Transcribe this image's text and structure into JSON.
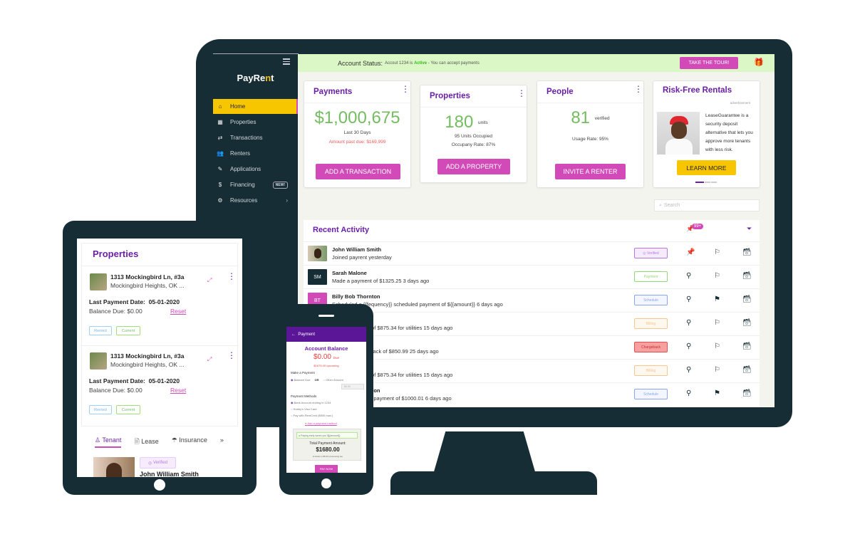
{
  "app": {
    "name_prefix": "PayRe",
    "name_accent": "n",
    "name_suffix": "t"
  },
  "sidebar": {
    "items": [
      {
        "label": "Home",
        "icon": "home-icon",
        "glyph": "⌂",
        "active": true
      },
      {
        "label": "Properties",
        "icon": "properties-icon",
        "glyph": "▦"
      },
      {
        "label": "Transactions",
        "icon": "transactions-icon",
        "glyph": "⇄"
      },
      {
        "label": "Renters",
        "icon": "renters-icon",
        "glyph": "👥"
      },
      {
        "label": "Applications",
        "icon": "applications-icon",
        "glyph": "✎"
      },
      {
        "label": "Financing",
        "icon": "money-bag-icon",
        "glyph": "$",
        "badge": "NEW!"
      },
      {
        "label": "Resources",
        "icon": "resources-icon",
        "glyph": "⚙",
        "chevron": "›"
      }
    ]
  },
  "status": {
    "label": "Account Status:",
    "msg_prefix": "Accout 1234 is",
    "state": "Active",
    "msg_suffix": "- You can accept payments",
    "tour_button": "TAKE THE TOUR!"
  },
  "cards": {
    "payments": {
      "title": "Payments",
      "amount": "$1,000,675",
      "period": "Last 30 Days",
      "past_due": "Amount past due: $169,999",
      "button": "ADD A TRANSACTION"
    },
    "properties": {
      "title": "Properties",
      "count": "180",
      "unit": "units",
      "occupied": "95 Units Occupied",
      "rate": "Occupany Rate: 87%",
      "button": "ADD A PROPERTY"
    },
    "people": {
      "title": "People",
      "count": "81",
      "unit": "verified",
      "usage": "Usage Rate: 95%",
      "button": "INVITE A RENTER"
    },
    "ad": {
      "title": "Risk-Free Rentals",
      "label": "advertisement",
      "text": "LeaseGuarantee is a security deposit alternative that lets you approve more tenants with less risk.",
      "button": "LEARN MORE"
    }
  },
  "search": {
    "placeholder": "Search"
  },
  "activity": {
    "title": "Recent Activity",
    "pin_count": "99+",
    "rows": [
      {
        "name": "John William Smith",
        "desc": "Joined payrent yesterday",
        "initials": "",
        "avatar_color": "#8a6a50",
        "tag": "Verified",
        "tag_color": "#b57ae0",
        "tag_bg": "#f5ebfd",
        "pinned": true,
        "flagged": false
      },
      {
        "name": "Sarah Malone",
        "desc": "Made a payment of $1325.25 3 days ago",
        "initials": "SM",
        "avatar_color": "#172d35",
        "tag": "Payment",
        "tag_color": "#8fd874",
        "tag_bg": "#ffffff",
        "pinned": false,
        "flagged": false
      },
      {
        "name": "Billy Bob Thornton",
        "desc": "Scheduled a {{fequency}} scheduled payment of ${{amount}} 6 days ago",
        "initials": "BT",
        "avatar_color": "#d14ab8",
        "tag": "Schedule",
        "tag_color": "#8aa6f0",
        "tag_bg": "#f3f6ff",
        "pinned": false,
        "flagged": true
      },
      {
        "name": "",
        "desc": "Added a charge of $875.34 for utilities 15 days ago",
        "initials": "",
        "avatar_color": "#ffffff",
        "tag": "Billing",
        "tag_color": "#f4c690",
        "tag_bg": "#fff8ee",
        "pinned": false,
        "flagged": false
      },
      {
        "name": "",
        "desc": "Issued a chargeback of $850.99 25 days ago",
        "initials": "",
        "avatar_color": "#ffffff",
        "tag": "Chargeback",
        "tag_color": "#e05050",
        "tag_bg": "#f8a0a0",
        "pinned": false,
        "flagged": false
      },
      {
        "name": "",
        "desc": "Added a charge of $875.34 for utilities 15 days ago",
        "initials": "",
        "avatar_color": "#ffffff",
        "tag": "Billing",
        "tag_color": "#f4c690",
        "tag_bg": "#fff8ee",
        "pinned": false,
        "flagged": false
      },
      {
        "name": "Billy Bob Thornton",
        "desc": "Made a one-time payment of $1000.01 6 days ago",
        "initials": "",
        "avatar_color": "#ffffff",
        "tag": "Schedule",
        "tag_color": "#8aa6f0",
        "tag_bg": "#f3f6ff",
        "pinned": false,
        "flagged": true
      }
    ]
  },
  "tablet": {
    "title": "Properties",
    "properties": [
      {
        "address": "1313 Mockingbird Ln, #3a",
        "city": "Mockingbird Heights, OK ...",
        "last_payment_label": "Last Payment Date:",
        "last_payment": "05-01-2020",
        "balance": "Balance Due: $0.00",
        "reset": "Reset",
        "tags": [
          "Rented",
          "Current"
        ]
      },
      {
        "address": "1313 Mockingbird Ln, #3a",
        "city": "Mockingbird Heights, OK ...",
        "last_payment_label": "Last Payment Date:",
        "last_payment": "05-01-2020",
        "balance": "Balance Due: $0.00",
        "reset": "Reset",
        "tags": [
          "Rented",
          "Current"
        ]
      }
    ],
    "tabs": [
      "Tenant",
      "Lease",
      "Insurance"
    ],
    "more": "»",
    "tenant": {
      "badge": "Verified",
      "name": "John William Smith"
    }
  },
  "phone": {
    "header": "Payment",
    "balance_title": "Account Balance",
    "balance": "$0.00",
    "due_label": "Due",
    "upcoming": "$1675.00 upcoming",
    "make_payment": "Make a Payment",
    "option_due": "Balance Due",
    "or": "OR",
    "option_other": "Other Amount",
    "other_value": "$0.00",
    "methods_title": "Payment Methods",
    "methods": [
      "Bank Account ending in 1234",
      "Hubby's Visa Card",
      "Pay with RentCred ($500 max.)"
    ],
    "add_method": "Add a payment method",
    "early_note": "Paying early saves you ${{amount}}",
    "total_label": "Total Payment Amount:",
    "total": "$1680.00",
    "fee_note": "includes a $5.00 processing fee",
    "pay_button": "PAY NOW"
  },
  "colors": {
    "brand_purple": "#6a1fa6",
    "accent_pink": "#d14ab8",
    "accent_yellow": "#f8c600",
    "positive_green": "#73bd60",
    "device_dark": "#172d35"
  }
}
